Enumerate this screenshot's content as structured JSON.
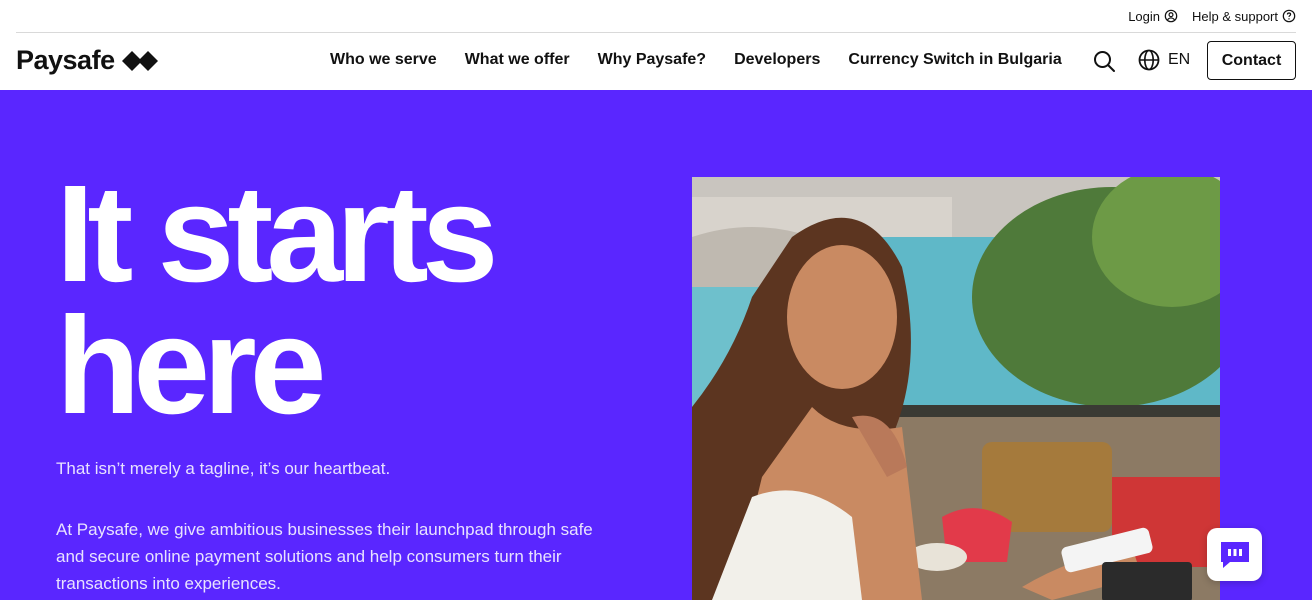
{
  "utility": {
    "login_label": "Login",
    "help_label": "Help & support"
  },
  "logo": {
    "text": "Paysafe"
  },
  "nav": {
    "items": [
      {
        "label": "Who we serve"
      },
      {
        "label": "What we offer"
      },
      {
        "label": "Why Paysafe?"
      },
      {
        "label": "Developers"
      },
      {
        "label": "Currency Switch in Bulgaria"
      }
    ],
    "language": "EN",
    "contact_label": "Contact"
  },
  "hero": {
    "title_line1": "It starts",
    "title_line2": "here",
    "tagline": "That isn’t merely a tagline, it’s our heartbeat.",
    "body": "At Paysafe, we give ambitious businesses their launchpad through safe and secure online payment solutions and help consumers turn their transactions into experiences."
  },
  "colors": {
    "brand_purple": "#5a26ff",
    "text_dark": "#111111",
    "hero_text": "#ffffff"
  },
  "icons": {
    "login": "user-circle-icon",
    "help": "question-circle-icon",
    "search": "search-icon",
    "language": "globe-icon",
    "chat": "chat-bubble-icon",
    "logo_mark": "double-diamond-icon"
  }
}
